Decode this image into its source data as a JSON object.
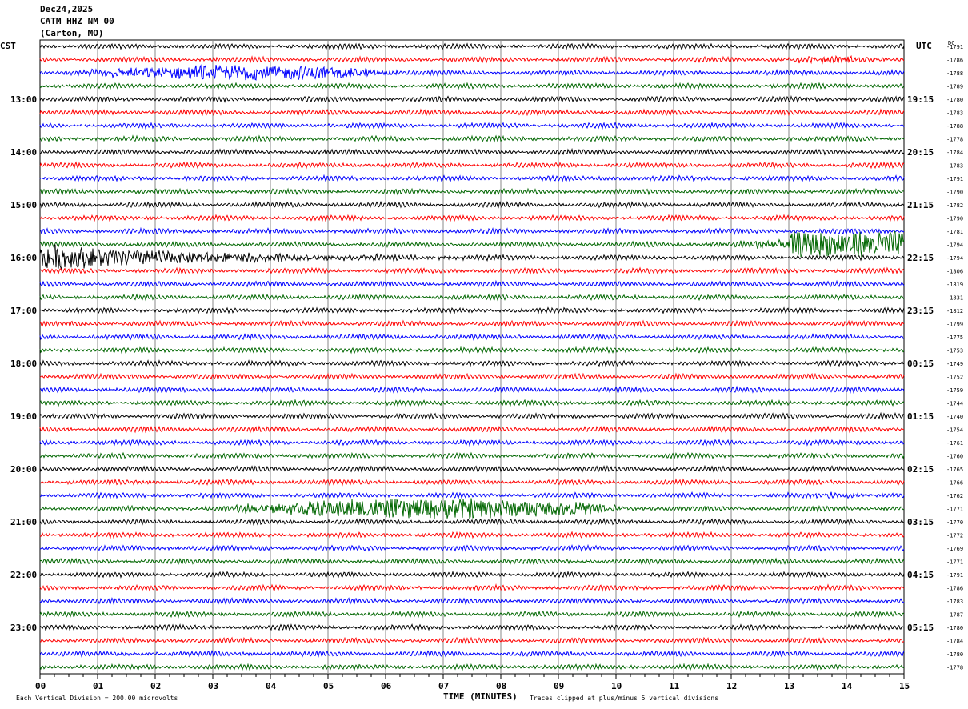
{
  "header": {
    "date": "Dec24,2025",
    "station": "CATM HHZ NM 00",
    "location": "(Carton, MO)"
  },
  "left_zone": "CST",
  "right_zone": "UTC",
  "dc_label": "DC",
  "footer": {
    "scale": "Each Vertical Division =  200.00 microvolts",
    "xlabel": "TIME (MINUTES)",
    "clip_note": "Traces clipped at plus/minus 5 vertical divisions"
  },
  "chart_data": {
    "type": "line",
    "xlabel": "TIME (MINUTES)",
    "xlim": [
      0,
      15
    ],
    "x_ticks": [
      "00",
      "01",
      "02",
      "03",
      "04",
      "05",
      "06",
      "07",
      "08",
      "09",
      "10",
      "11",
      "12",
      "13",
      "14",
      "15"
    ],
    "grid": "vertical lines every minute",
    "trace_colors": [
      "#000000",
      "#ff0000",
      "#0000ff",
      "#006600"
    ],
    "left_time_labels": [
      {
        "trace": 4,
        "label": "13:00"
      },
      {
        "trace": 8,
        "label": "14:00"
      },
      {
        "trace": 12,
        "label": "15:00"
      },
      {
        "trace": 16,
        "label": "16:00"
      },
      {
        "trace": 20,
        "label": "17:00"
      },
      {
        "trace": 24,
        "label": "18:00"
      },
      {
        "trace": 28,
        "label": "19:00"
      },
      {
        "trace": 32,
        "label": "20:00"
      },
      {
        "trace": 36,
        "label": "21:00"
      },
      {
        "trace": 40,
        "label": "22:00"
      },
      {
        "trace": 44,
        "label": "23:00"
      }
    ],
    "right_time_labels": [
      {
        "trace": 4,
        "label": "19:15"
      },
      {
        "trace": 8,
        "label": "20:15"
      },
      {
        "trace": 12,
        "label": "21:15"
      },
      {
        "trace": 16,
        "label": "22:15"
      },
      {
        "trace": 20,
        "label": "23:15"
      },
      {
        "trace": 24,
        "label": "00:15"
      },
      {
        "trace": 28,
        "label": "01:15"
      },
      {
        "trace": 32,
        "label": "02:15"
      },
      {
        "trace": 36,
        "label": "03:15"
      },
      {
        "trace": 40,
        "label": "04:15"
      },
      {
        "trace": 44,
        "label": "05:15"
      }
    ],
    "dc_offsets": [
      -1791,
      -1786,
      -1788,
      -1789,
      -1780,
      -1783,
      -1788,
      -1778,
      -1784,
      -1783,
      -1791,
      -1790,
      -1782,
      -1790,
      -1781,
      -1794,
      -1794,
      -1806,
      -1819,
      -1831,
      -1812,
      -1799,
      -1775,
      -1753,
      -1749,
      -1752,
      -1759,
      -1744,
      -1740,
      -1754,
      -1761,
      -1760,
      -1765,
      -1766,
      -1762,
      -1771,
      -1770,
      -1772,
      -1769,
      -1771,
      -1791,
      -1786,
      -1783,
      -1787,
      -1780,
      -1784,
      -1780,
      -1778
    ],
    "events": [
      {
        "trace": 1,
        "start": 12.5,
        "end": 15,
        "amplitude": 0.8
      },
      {
        "trace": 2,
        "start": 0.5,
        "end": 6.5,
        "amplitude": 2.5
      },
      {
        "trace": 15,
        "start": 11,
        "end": 15,
        "amplitude": 4.5
      },
      {
        "trace": 16,
        "start": 0,
        "end": 8,
        "amplitude": 5
      },
      {
        "trace": 34,
        "start": 13,
        "end": 15,
        "amplitude": 0.6
      },
      {
        "trace": 35,
        "start": 3,
        "end": 10.5,
        "amplitude": 3.5
      }
    ]
  }
}
